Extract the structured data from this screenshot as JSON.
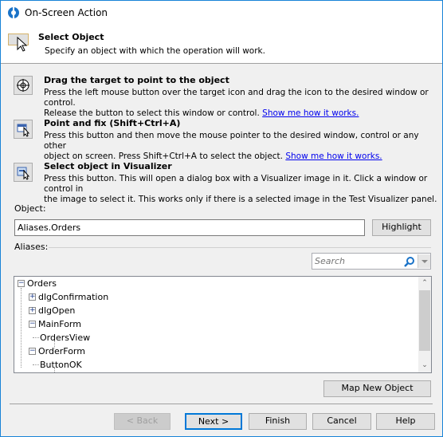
{
  "window": {
    "title": "On-Screen Action"
  },
  "header": {
    "title": "Select Object",
    "subtitle": "Specify an object with which the operation will work."
  },
  "methods": [
    {
      "title": "Drag the target to point to the object",
      "line1": "Press the left mouse button over the target icon and drag the icon to the desired window or control.",
      "line2": "Release the button to select this window or control.",
      "link": "Show me how it works.",
      "icon": "target-icon"
    },
    {
      "title": "Point and fix (Shift+Ctrl+A)",
      "line1": "Press this button and then move the mouse pointer to the desired window, control or any other",
      "line2": "object on screen. Press Shift+Ctrl+A to select the object.",
      "link": "Show me how it works.",
      "icon": "point-fix-icon"
    },
    {
      "title": "Select object in Visualizer",
      "line1": "Press this button. This will open a dialog box with a Visualizer image in it. Click a window or control in",
      "line2": "the image to select it. This works only if there is a selected image in the Test Visualizer panel.",
      "icon": "visualizer-icon"
    }
  ],
  "object": {
    "label": "Object:",
    "value": "Aliases.Orders",
    "highlight": "Highlight"
  },
  "aliases": {
    "label": "Aliases:",
    "search_placeholder": "Search",
    "tree": [
      {
        "label": "Orders",
        "level": 0,
        "toggle": "-"
      },
      {
        "label": "dlgConfirmation",
        "level": 1,
        "toggle": "+"
      },
      {
        "label": "dlgOpen",
        "level": 1,
        "toggle": "+"
      },
      {
        "label": "MainForm",
        "level": 1,
        "toggle": "-"
      },
      {
        "label": "OrdersView",
        "level": 2,
        "toggle": ""
      },
      {
        "label": "OrderForm",
        "level": 1,
        "toggle": "-"
      },
      {
        "label": "ButtonOK",
        "level": 2,
        "toggle": ""
      }
    ]
  },
  "map_new": "Map New Object",
  "footer": {
    "back": "< Back",
    "next": "Next >",
    "finish": "Finish",
    "cancel": "Cancel",
    "help": "Help"
  }
}
